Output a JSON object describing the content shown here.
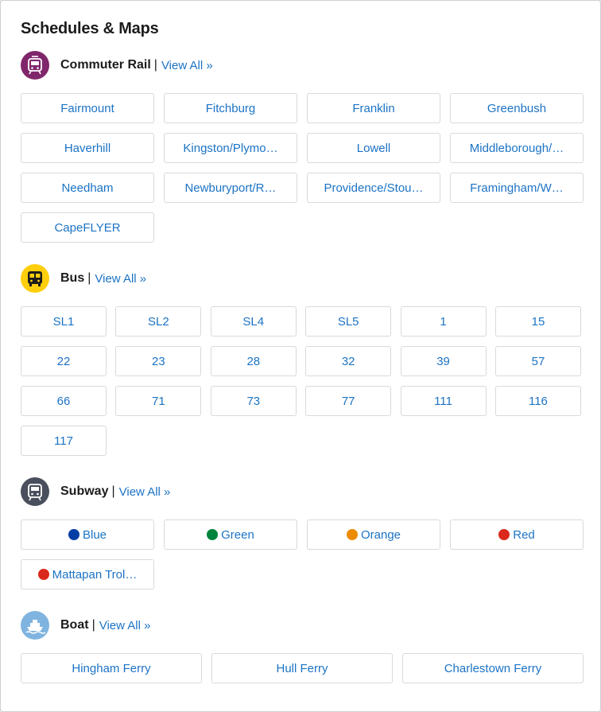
{
  "title": "Schedules & Maps",
  "view_all": "View All »",
  "separator": "|",
  "colors": {
    "link": "#1c73c4",
    "commuter_rail": "#80276c",
    "bus": "#ffce0c",
    "subway": "#494f5c",
    "boat": "#80b4e0"
  },
  "commuter_rail": {
    "name": "Commuter Rail",
    "icon": "commuter-rail-icon",
    "lines": [
      "Fairmount",
      "Fitchburg",
      "Franklin",
      "Greenbush",
      "Haverhill",
      "Kingston/Plymo…",
      "Lowell",
      "Middleborough/…",
      "Needham",
      "Newburyport/R…",
      "Providence/Stou…",
      "Framingham/W…",
      "CapeFLYER"
    ]
  },
  "bus": {
    "name": "Bus",
    "icon": "bus-icon",
    "routes": [
      "SL1",
      "SL2",
      "SL4",
      "SL5",
      "1",
      "15",
      "22",
      "23",
      "28",
      "32",
      "39",
      "57",
      "66",
      "71",
      "73",
      "77",
      "111",
      "116",
      "117"
    ]
  },
  "subway": {
    "name": "Subway",
    "icon": "subway-icon",
    "lines": [
      {
        "label": "Blue",
        "color": "#003da5"
      },
      {
        "label": "Green",
        "color": "#00843d"
      },
      {
        "label": "Orange",
        "color": "#ed8b00"
      },
      {
        "label": "Red",
        "color": "#da291c"
      },
      {
        "label": "Mattapan Trol…",
        "color": "#da291c"
      }
    ]
  },
  "boat": {
    "name": "Boat",
    "icon": "boat-icon",
    "lines": [
      "Hingham Ferry",
      "Hull Ferry",
      "Charlestown Ferry"
    ]
  }
}
